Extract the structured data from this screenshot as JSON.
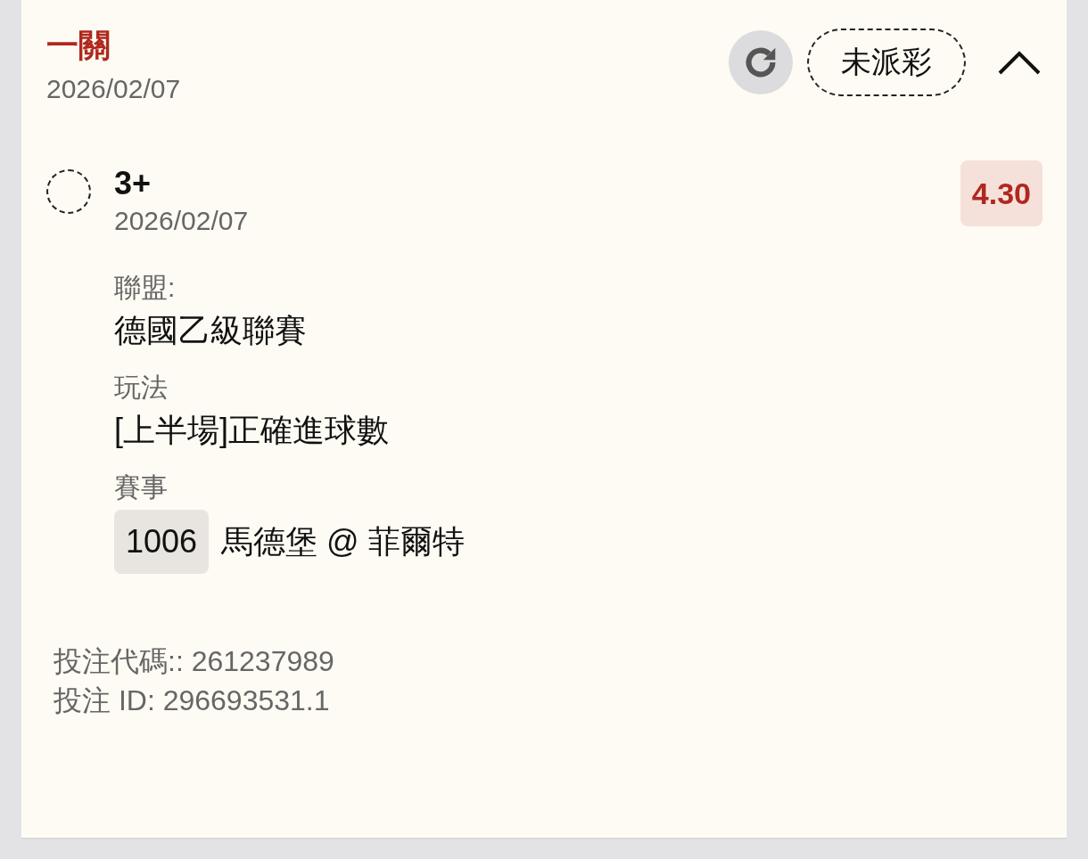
{
  "bet": {
    "title": "一關",
    "date": "2026/02/07",
    "status": "未派彩",
    "expanded": true
  },
  "selection": {
    "name": "3+",
    "date": "2026/02/07",
    "odds": "4.30",
    "selected": false
  },
  "details": [
    {
      "label": "聯盟:",
      "value": "德國乙級聯賽"
    },
    {
      "label": "玩法",
      "value": "[上半場]正確進球數"
    },
    {
      "label": "賽事",
      "match_number": "1006",
      "value": "馬德堡 @ 菲爾特"
    }
  ],
  "references": [
    "投注代碼:: 261237989",
    "投注 ID: 296693531.1"
  ]
}
